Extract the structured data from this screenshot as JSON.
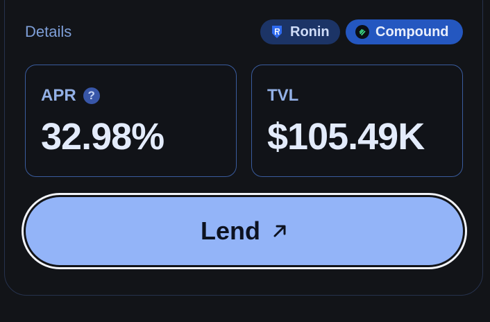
{
  "details": {
    "label": "Details"
  },
  "badges": [
    {
      "label": "Ronin",
      "icon": "ronin-shield-icon",
      "color": "#1c3466"
    },
    {
      "label": "Compound",
      "icon": "compound-logo-icon",
      "color": "#2457c0"
    }
  ],
  "stats": {
    "apr": {
      "label": "APR",
      "value": "32.98%",
      "help_icon": "question-mark-icon"
    },
    "tvl": {
      "label": "TVL",
      "value": "$105.49K"
    }
  },
  "action": {
    "label": "Lend",
    "icon": "arrow-up-right-icon",
    "color": "#93b4f8"
  },
  "colors": {
    "background": "#121418",
    "accent": "#93b4f8",
    "card_border": "#3a5c9e"
  }
}
